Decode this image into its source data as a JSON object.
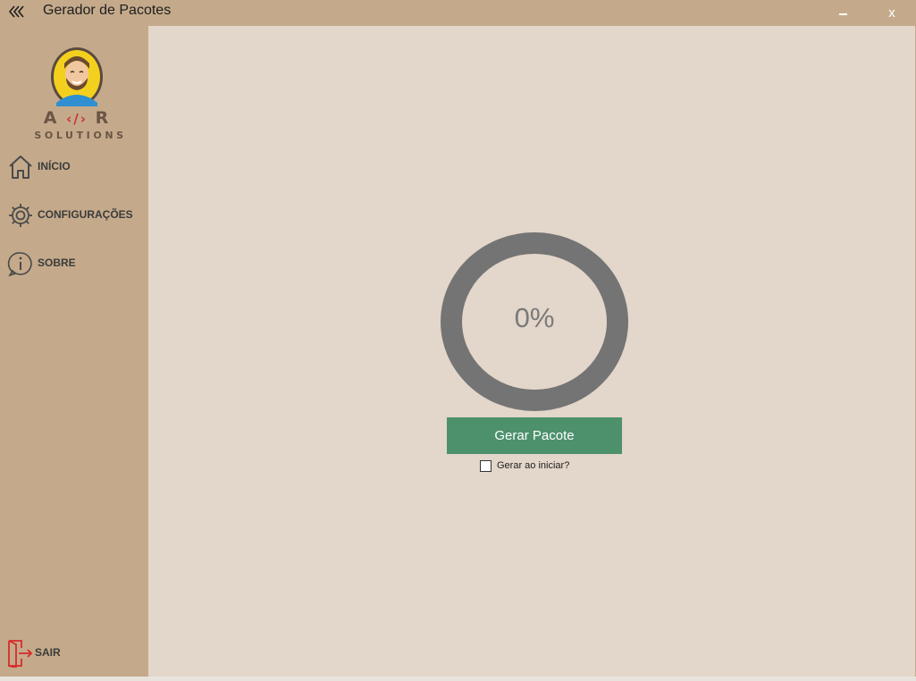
{
  "window": {
    "title": "Gerador de Pacotes",
    "close_label": "x"
  },
  "logo": {
    "brand_left": "A",
    "brand_mid": "‹/›",
    "brand_right": "R",
    "solutions": "SOLUTIONS"
  },
  "sidebar": {
    "items": [
      {
        "label": "INÍCIO",
        "icon": "home-icon"
      },
      {
        "label": "CONFIGURAÇÕES",
        "icon": "gear-icon"
      },
      {
        "label": "SOBRE",
        "icon": "info-icon"
      }
    ],
    "exit": {
      "label": "SAIR",
      "icon": "exit-icon"
    }
  },
  "main": {
    "progress": {
      "value": 0,
      "label": "0%"
    },
    "generate_button": "Gerar Pacote",
    "auto_generate": {
      "label": "Gerar ao iniciar?",
      "checked": false
    }
  },
  "colors": {
    "sidebar_bg": "#c4aa8b",
    "main_bg": "#e3d6ca",
    "ring": "#747474",
    "button": "#4c916b",
    "exit_red": "#d92b2b"
  }
}
